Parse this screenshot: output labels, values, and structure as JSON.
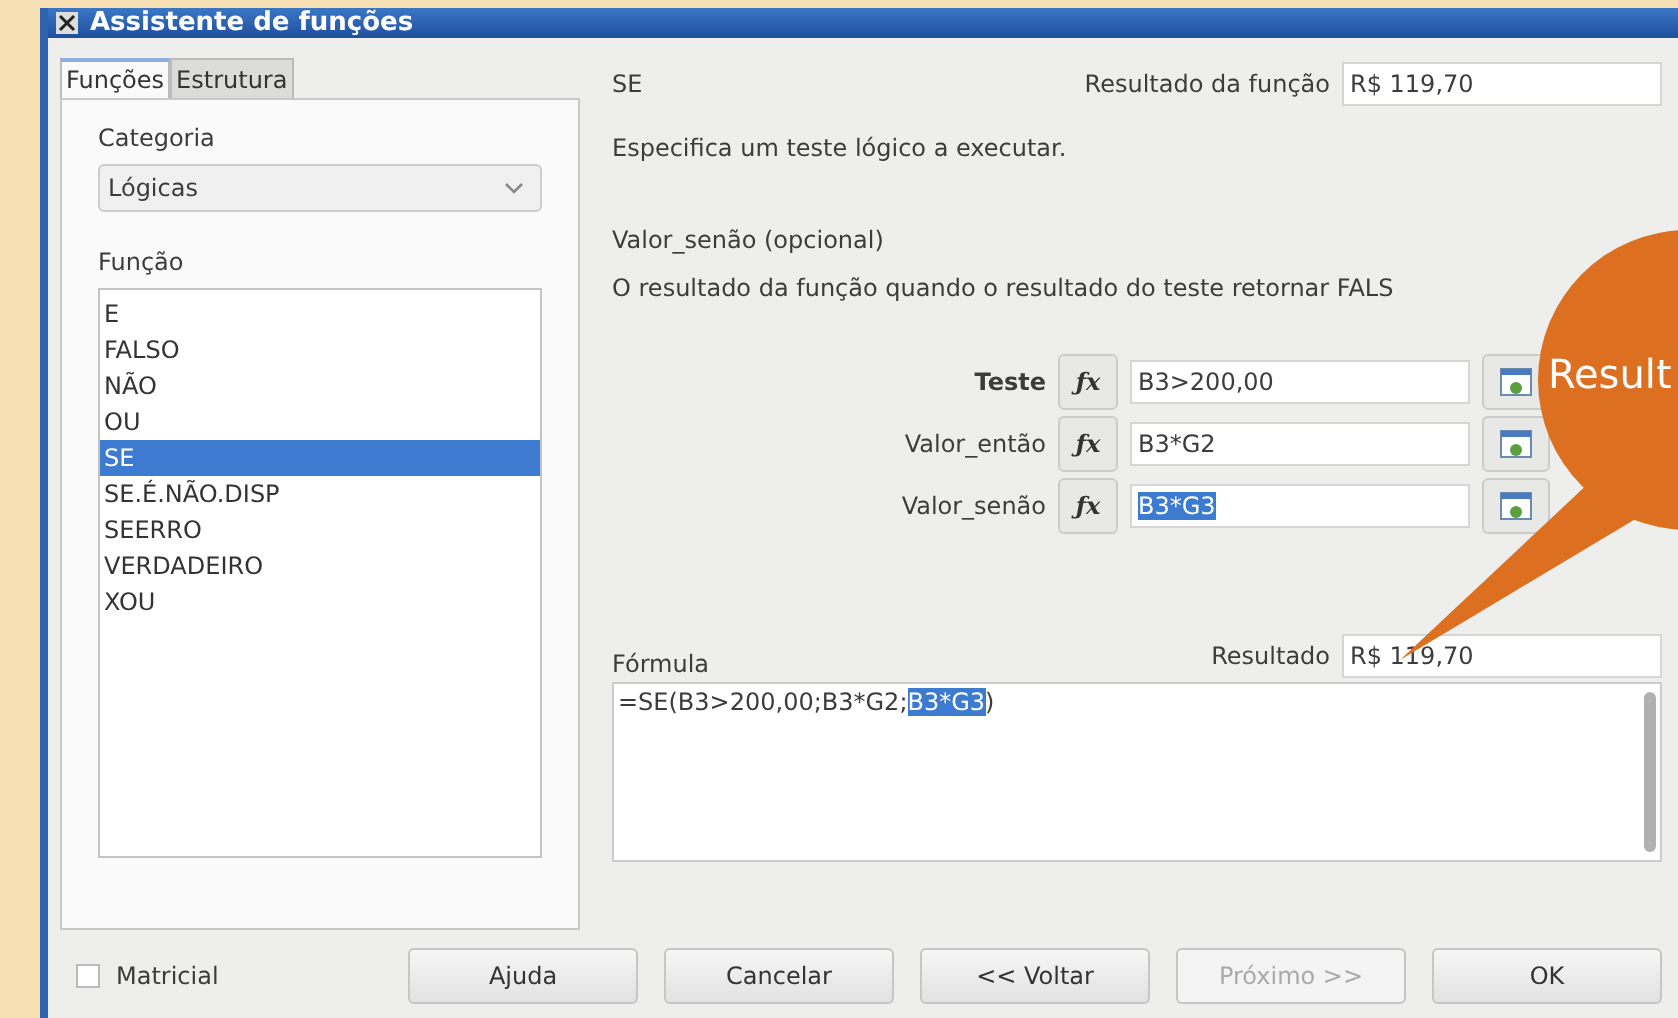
{
  "window": {
    "title": "Assistente de funções"
  },
  "tabs": [
    {
      "label": "Funções",
      "selected": true
    },
    {
      "label": "Estrutura",
      "selected": false
    }
  ],
  "category": {
    "label": "Categoria",
    "value": "Lógicas"
  },
  "function_list": {
    "label": "Função",
    "items": [
      {
        "label": "E",
        "selected": false
      },
      {
        "label": "FALSO",
        "selected": false
      },
      {
        "label": "NÃO",
        "selected": false
      },
      {
        "label": "OU",
        "selected": false
      },
      {
        "label": "SE",
        "selected": true
      },
      {
        "label": "SE.É.NÃO.DISP",
        "selected": false
      },
      {
        "label": "SEERRO",
        "selected": false
      },
      {
        "label": "VERDADEIRO",
        "selected": false
      },
      {
        "label": "XOU",
        "selected": false
      }
    ]
  },
  "function_name": "SE",
  "function_result": {
    "label": "Resultado da função",
    "value": "R$ 119,70"
  },
  "description": "Especifica um teste lógico a executar.",
  "argument_title": "Valor_senão (opcional)",
  "argument_description": "O resultado da função quando o resultado do teste retornar FALS",
  "arguments": [
    {
      "label": "Teste",
      "bold": true,
      "button": "ƒx",
      "value": "B3>200,00",
      "selected": false
    },
    {
      "label": "Valor_então",
      "bold": false,
      "button": "ƒx",
      "value": "B3*G2",
      "selected": false
    },
    {
      "label": "Valor_senão",
      "bold": false,
      "button": "ƒx",
      "value": "B3*G3",
      "selected": true
    }
  ],
  "result": {
    "label": "Resultado",
    "value": "R$ 119,70"
  },
  "formula": {
    "label": "Fórmula",
    "before": "=SE(B3>200,00;B3*G2;",
    "selection": "B3*G3",
    "after": ")"
  },
  "matricial": {
    "label": "Matricial",
    "checked": false
  },
  "buttons": [
    {
      "label": "Ajuda",
      "disabled": false
    },
    {
      "label": "Cancelar",
      "disabled": false
    },
    {
      "label": "<< Voltar",
      "disabled": false
    },
    {
      "label": "Próximo >>",
      "disabled": true
    },
    {
      "label": "OK",
      "disabled": false
    }
  ],
  "callout": {
    "text": "Result"
  }
}
